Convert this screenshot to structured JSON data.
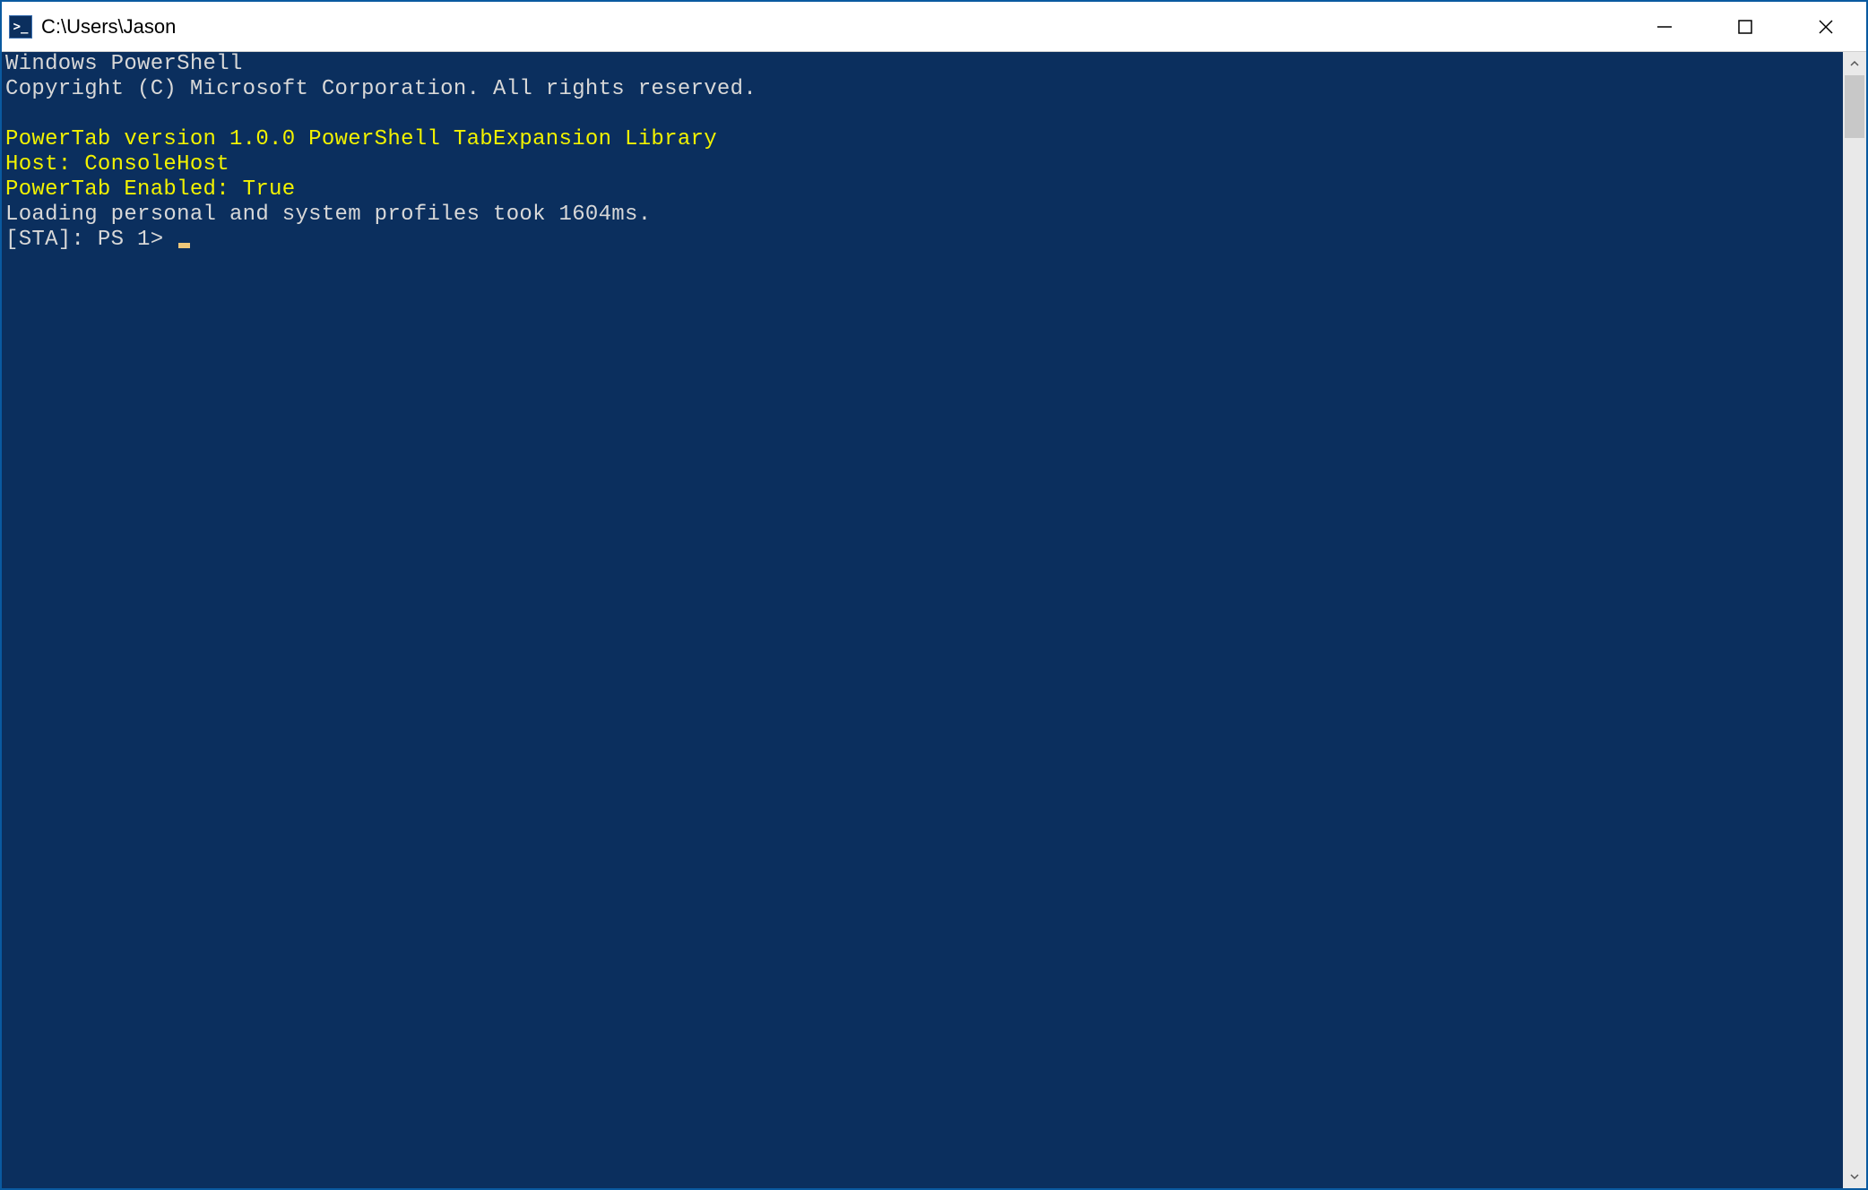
{
  "titlebar": {
    "icon_glyph": ">_",
    "title": "C:\\Users\\Jason"
  },
  "terminal": {
    "lines": {
      "header1": "Windows PowerShell",
      "header2": "Copyright (C) Microsoft Corporation. All rights reserved.",
      "blank1": "",
      "powertab1": "PowerTab version 1.0.0 PowerShell TabExpansion Library",
      "powertab2": "Host: ConsoleHost",
      "powertab3": "PowerTab Enabled: True",
      "profiles": "Loading personal and system profiles took 1604ms.",
      "prompt": "[STA]: PS 1> "
    }
  },
  "colors": {
    "terminal_bg": "#0b2f5e",
    "text_white": "#d8d8d8",
    "text_yellow": "#f2f200",
    "cursor": "#eec77a"
  }
}
